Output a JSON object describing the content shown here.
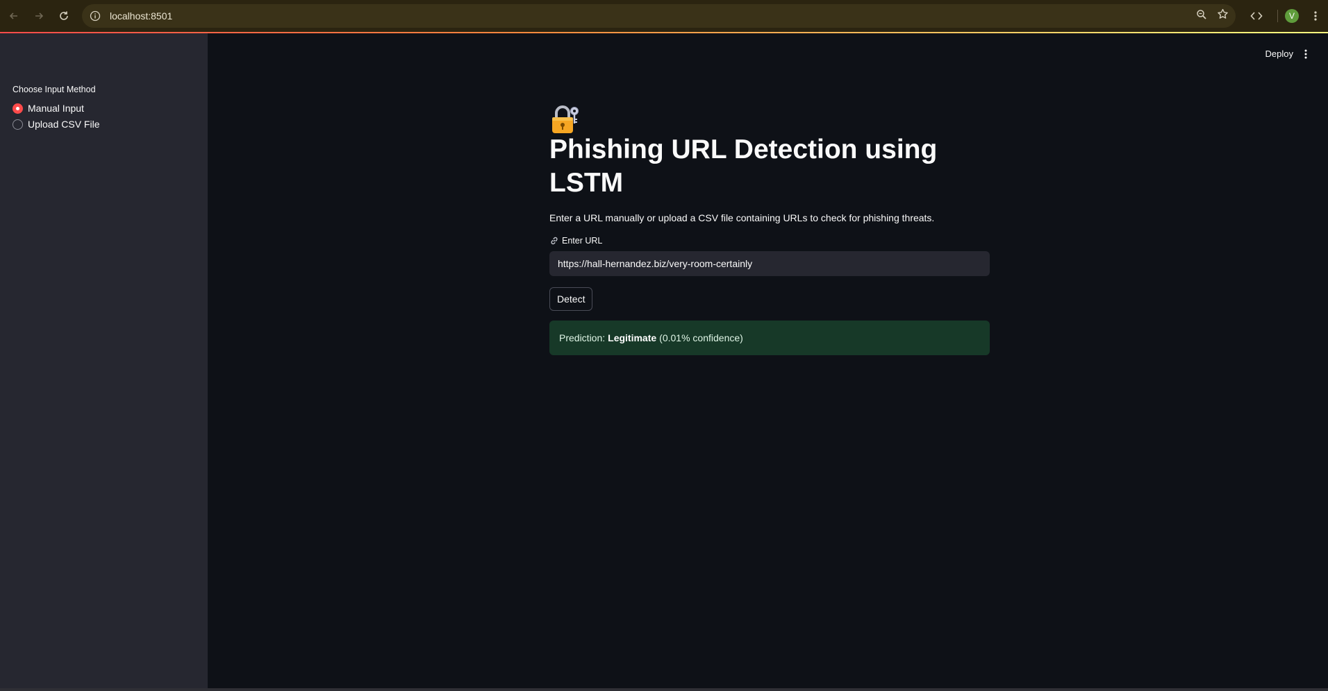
{
  "browser": {
    "url": "localhost:8501",
    "avatar_letter": "V"
  },
  "sidebar": {
    "radio_title": "Choose Input Method",
    "options": [
      {
        "label": "Manual Input",
        "selected": true
      },
      {
        "label": "Upload CSV File",
        "selected": false
      }
    ]
  },
  "header": {
    "deploy_label": "Deploy"
  },
  "main": {
    "title": "Phishing URL Detection using LSTM",
    "description": "Enter a URL manually or upload a CSV file containing URLs to check for phishing threats.",
    "url_field_label": "Enter URL",
    "url_value": "https://hall-hernandez.biz/very-room-certainly",
    "detect_label": "Detect",
    "result": {
      "prefix": "Prediction:",
      "label": "Legitimate",
      "suffix": "(0.01% confidence)"
    }
  },
  "colors": {
    "accent": "#ff4b4b",
    "success_bg": "#173928",
    "sidebar_bg": "#262730",
    "main_bg": "#0e1117"
  }
}
